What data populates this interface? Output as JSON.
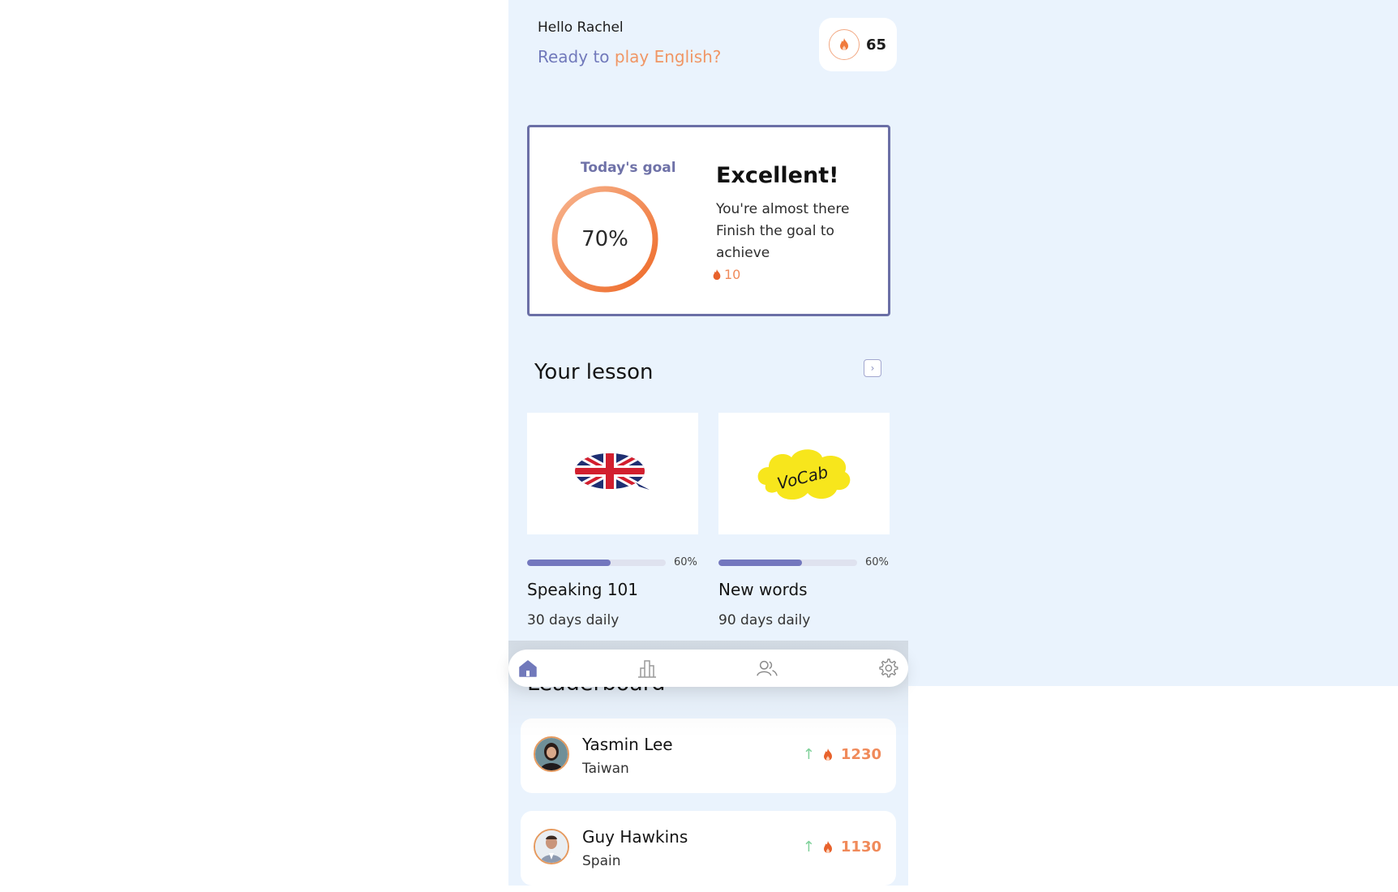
{
  "greeting": {
    "hello": "Hello Rachel",
    "prompt_prefix": "Ready to",
    "prompt_accent": "play English?"
  },
  "streak": {
    "count": "65",
    "icon": "flame-icon"
  },
  "goal": {
    "label": "Today's goal",
    "percent_text": "70%",
    "progress": 0.7,
    "title": "Excellent!",
    "description": "You're almost there Finish the goal to achieve",
    "reward": "10"
  },
  "lessons": {
    "title": "Your lesson",
    "items": [
      {
        "name": "Speaking 101",
        "schedule": "30 days daily",
        "progress_text": "60%",
        "progress": 0.6,
        "image": "uk-flag-speech-bubble"
      },
      {
        "name": "New words",
        "schedule": "90 days daily",
        "progress_text": "60%",
        "progress": 0.6,
        "image": "vocab-cloud",
        "image_text": "VoCab"
      }
    ]
  },
  "leaderboard": {
    "title": "Leaderboard",
    "entries": [
      {
        "name": "Yasmin Lee",
        "country": "Taiwan",
        "points": "1230",
        "trend": "up"
      },
      {
        "name": "Guy Hawkins",
        "country": "Spain",
        "points": "1130",
        "trend": "up"
      }
    ]
  },
  "nav": {
    "items": [
      {
        "icon": "home-icon",
        "active": true
      },
      {
        "icon": "stats-icon",
        "active": false
      },
      {
        "icon": "users-icon",
        "active": false
      },
      {
        "icon": "gear-icon",
        "active": false
      }
    ]
  },
  "colors": {
    "background": "#eaf3fd",
    "accent": "#f09665",
    "primary": "#7179bb",
    "ring": "#f07a3c"
  }
}
